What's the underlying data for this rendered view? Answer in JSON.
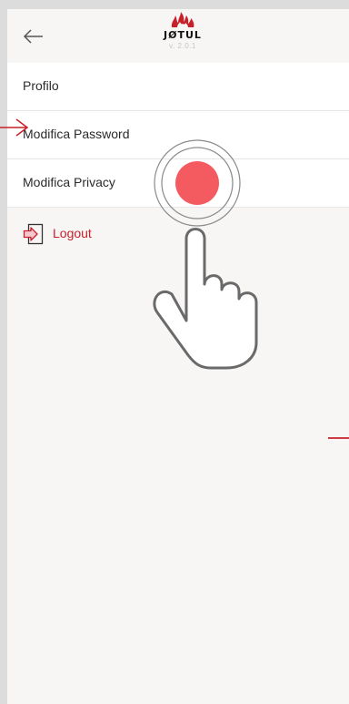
{
  "header": {
    "logo_text": "JØTUL",
    "version": "v. 2.0.1",
    "back_icon": "back-arrow-icon"
  },
  "menu": {
    "items": [
      {
        "label": "Profilo"
      },
      {
        "label": "Modifica Password"
      },
      {
        "label": "Modifica Privacy"
      }
    ]
  },
  "logout": {
    "label": "Logout",
    "icon": "logout-icon"
  },
  "colors": {
    "brand_red": "#c8202a",
    "tap_indicator": "#f45b60",
    "background": "#f7f6f5",
    "item_background": "#ffffff",
    "frame": "#dcdcdc"
  }
}
